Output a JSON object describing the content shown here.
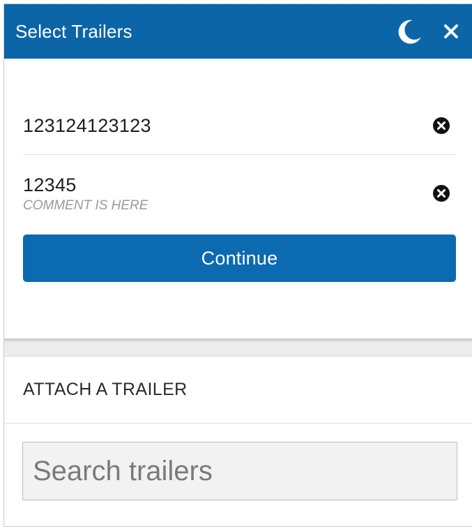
{
  "header": {
    "title": "Select Trailers",
    "theme_toggle_icon": "moon-icon",
    "close_icon": "close-icon"
  },
  "selected_trailers": [
    {
      "number": "123124123123",
      "comment": ""
    },
    {
      "number": "12345",
      "comment": "COMMENT IS HERE"
    }
  ],
  "actions": {
    "continue_label": "Continue"
  },
  "attach": {
    "title": "ATTACH A TRAILER",
    "search_placeholder": "Search trailers",
    "search_value": ""
  },
  "colors": {
    "brand": "#0b65a6",
    "button": "#0b6ab0",
    "comment": "#9a9a9a"
  }
}
